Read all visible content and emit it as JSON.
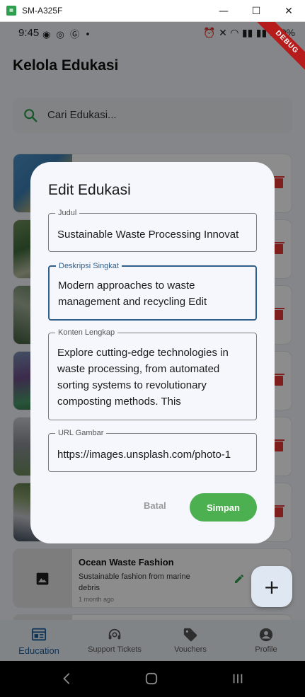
{
  "window": {
    "title": "SM-A325F"
  },
  "status_bar": {
    "time": "9:45",
    "battery": "100%"
  },
  "debug_badge": "DEBUG",
  "page": {
    "title": "Kelola Edukasi"
  },
  "search": {
    "placeholder": "Cari Edukasi..."
  },
  "list": {
    "visible_card": {
      "title": "Ocean Waste Fashion",
      "description": "Sustainable fashion from marine debris",
      "time": "1 month ago"
    }
  },
  "dialog": {
    "title": "Edit Edukasi",
    "fields": [
      {
        "label": "Judul",
        "value": "Sustainable Waste Processing Innovat"
      },
      {
        "label": "Deskripsi Singkat",
        "value": "Modern approaches to waste management and recycling Edit"
      },
      {
        "label": "Konten Lengkap",
        "value": "Explore cutting-edge technologies in waste processing, from automated sorting systems to revolutionary composting methods. This"
      },
      {
        "label": "URL Gambar",
        "value": "https://images.unsplash.com/photo-1"
      }
    ],
    "cancel_label": "Batal",
    "save_label": "Simpan"
  },
  "bottom_nav": {
    "items": [
      {
        "label": "Education",
        "icon": "education-icon"
      },
      {
        "label": "Support Tickets",
        "icon": "support-icon"
      },
      {
        "label": "Vouchers",
        "icon": "voucher-icon"
      },
      {
        "label": "Profile",
        "icon": "profile-icon"
      }
    ]
  },
  "colors": {
    "accent": "#4caf50",
    "primary": "#1a5fa0",
    "delete": "#e53935"
  }
}
